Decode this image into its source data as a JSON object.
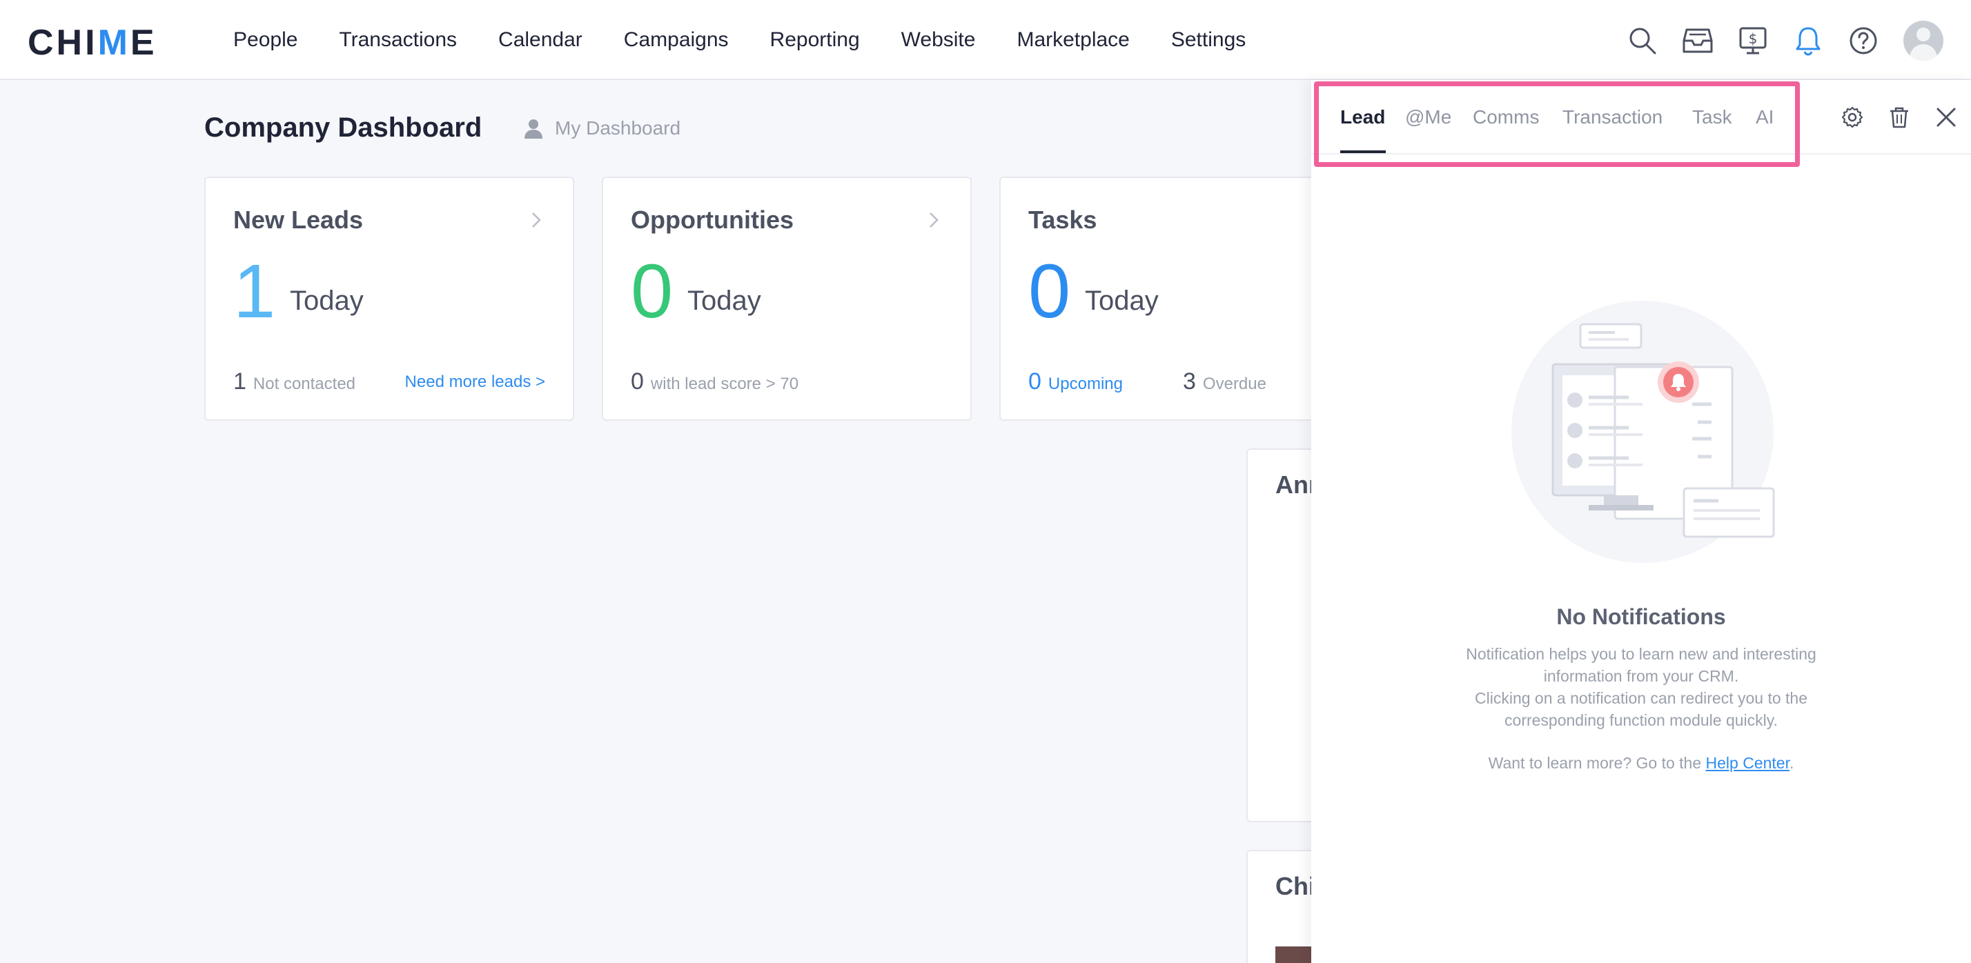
{
  "app": {
    "logo_prefix": "CHI",
    "logo_check": "M",
    "logo_suffix": "E"
  },
  "nav": {
    "items": [
      "People",
      "Transactions",
      "Calendar",
      "Campaigns",
      "Reporting",
      "Website",
      "Marketplace",
      "Settings"
    ]
  },
  "header_icons": [
    "search-icon",
    "inbox-icon",
    "billing-icon",
    "bell-icon",
    "help-icon",
    "avatar"
  ],
  "dashboard": {
    "title": "Company Dashboard",
    "switch_label": "My Dashboard"
  },
  "cards": {
    "new_leads": {
      "title": "New Leads",
      "value": "1",
      "period": "Today",
      "foot_num": "1",
      "foot_text": "Not contacted",
      "link": "Need more leads >",
      "color": "#5ab8f5"
    },
    "opportunities": {
      "title": "Opportunities",
      "value": "0",
      "period": "Today",
      "foot_num": "0",
      "foot_text": "with lead score > 70",
      "color": "#36c777"
    },
    "tasks": {
      "title": "Tasks",
      "value": "0",
      "period": "Today",
      "upcoming_num": "0",
      "upcoming_text": "Upcoming",
      "overdue_num": "3",
      "overdue_text": "Overdue",
      "color": "#2d8cf0"
    }
  },
  "partial_cards": {
    "card_a_title": "Ann",
    "card_b_title": "Chi"
  },
  "notifications": {
    "tabs": [
      "Lead",
      "@Me",
      "Comms",
      "Transaction",
      "Task",
      "AI"
    ],
    "active_tab": "Lead",
    "empty_title": "No Notifications",
    "desc_line1": "Notification helps you to learn new and interesting",
    "desc_line2": "information from your CRM.",
    "desc_line3": "Clicking on a notification can redirect you to the",
    "desc_line4": "corresponding function module quickly.",
    "learn_more": "Want to learn more? Go to the ",
    "help_link": "Help Center",
    "period": "."
  },
  "colors": {
    "accent": "#2d8cf0",
    "highlight": "#f0609a",
    "bell_badge": "#f47f83"
  }
}
